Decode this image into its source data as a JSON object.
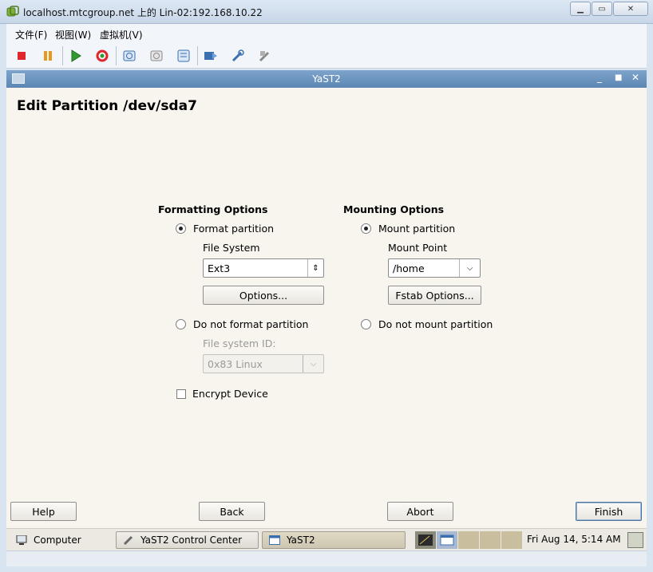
{
  "host": {
    "title": "localhost.mtcgroup.net 上的 Lin-02:192.168.10.22",
    "menu": [
      "文件(F)",
      "视图(W)",
      "虚拟机(V)"
    ]
  },
  "yast": {
    "window_title": "YaST2",
    "page_title": "Edit Partition /dev/sda7",
    "formatting": {
      "title": "Formatting Options",
      "format_partition": "Format partition",
      "file_system_label": "File System",
      "file_system_value": "Ext3",
      "options_button": "Options...",
      "do_not_format": "Do not format partition",
      "fs_id_label": "File system ID:",
      "fs_id_value": "0x83 Linux",
      "encrypt": "Encrypt Device"
    },
    "mounting": {
      "title": "Mounting Options",
      "mount_partition": "Mount partition",
      "mount_point_label": "Mount Point",
      "mount_point_value": "/home",
      "fstab_button": "Fstab Options...",
      "do_not_mount": "Do not mount partition"
    },
    "buttons": {
      "help": "Help",
      "back": "Back",
      "abort": "Abort",
      "finish": "Finish"
    }
  },
  "taskbar": {
    "computer": "Computer",
    "task1": "YaST2 Control Center",
    "task2": "YaST2",
    "clock": "Fri Aug 14,  5:14 AM"
  },
  "colors": {
    "yast_title_bg": "#6b93be",
    "body_bg": "#f8f5ee"
  }
}
